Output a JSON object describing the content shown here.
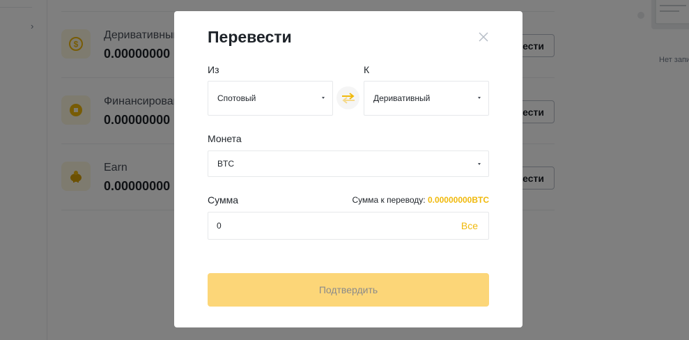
{
  "background": {
    "accounts": [
      {
        "name": "Деривативный",
        "balance": "0.00000000",
        "button": "Перевести",
        "icon": "dollar-coin-icon"
      },
      {
        "name": "Финансирование",
        "balance": "0.00000000",
        "button": "Перевести",
        "icon": "coin-square-icon"
      },
      {
        "name": "Earn",
        "balance": "0.00000000",
        "button": "Перевести",
        "icon": "piggy-bank-icon"
      }
    ],
    "empty_state": "Нет записей"
  },
  "modal": {
    "title": "Перевести",
    "from_label": "Из",
    "from_value": "Спотовый",
    "to_label": "К",
    "to_value": "Деривативный",
    "coin_label": "Монета",
    "coin_value": "BTC",
    "amount_label": "Сумма",
    "transferable_label": "Сумма к переводу:",
    "transferable_value": "0.00000000BTC",
    "amount_value": "0",
    "max_label": "Все",
    "confirm_label": "Подтвердить"
  },
  "colors": {
    "accent": "#f0b90b",
    "confirm_disabled": "#fcd678",
    "overlay": "rgba(0,0,0,0.5)"
  }
}
